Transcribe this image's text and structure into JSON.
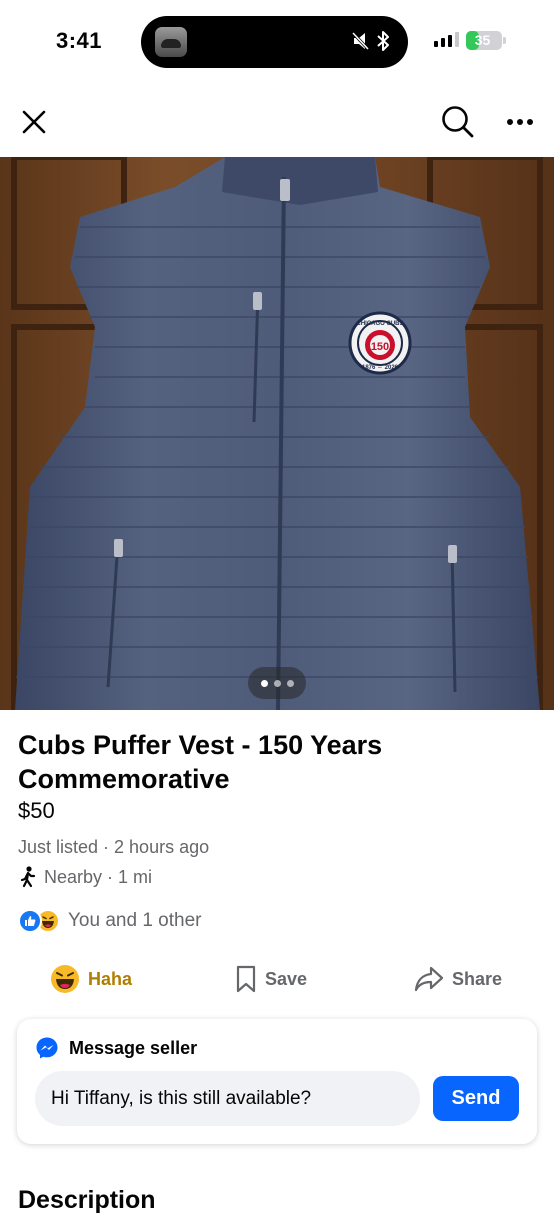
{
  "status_bar": {
    "time": "3:41",
    "battery_level": "35",
    "battery_fraction": 0.35,
    "icons": [
      "music-thumbnail-icon",
      "mute-bell-icon",
      "bluetooth-icon",
      "cellular-signal-icon",
      "battery-charging-icon"
    ]
  },
  "nav": {
    "close_icon": "close-icon",
    "search_icon": "search-icon",
    "more_icon": "more-options-icon"
  },
  "photo": {
    "patch_top_text": "CHICAGO CUBS",
    "patch_number": "150",
    "patch_bottom_text": "1876 ⇔ 2026",
    "carousel_total": 3,
    "carousel_active": 1
  },
  "listing": {
    "title": "Cubs Puffer Vest - 150 Years Commemorative",
    "price": "$50",
    "listed": "Just listed · 2 hours ago",
    "distance": "Nearby · 1 mi"
  },
  "reactions": {
    "text": "You and 1 other"
  },
  "actions": {
    "haha_label": "Haha",
    "save_label": "Save",
    "share_label": "Share"
  },
  "message": {
    "heading": "Message seller",
    "input_value": "Hi Tiffany, is this still available?",
    "send_label": "Send"
  },
  "description": {
    "heading": "Description"
  },
  "colors": {
    "accent_blue": "#0866ff",
    "haha_yellow": "#f7b928",
    "haha_text": "#b07e00",
    "secondary_text": "#65676b",
    "vest_navy": "#4a5777",
    "door_wood": "#6b4426"
  }
}
